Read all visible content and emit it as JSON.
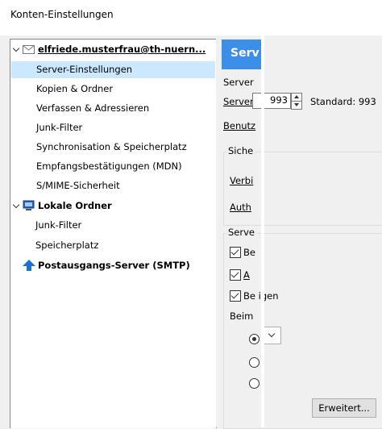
{
  "window": {
    "title": "Konten-Einstellungen"
  },
  "sidebar": {
    "account_email": "elfriede.musterfrau@th-nuern...",
    "account_items": [
      "Server-Einstellungen",
      "Kopien & Ordner",
      "Verfassen & Adressieren",
      "Junk-Filter",
      "Synchronisation & Speicherplatz",
      "Empfangsbestätigungen (MDN)",
      "S/MIME-Sicherheit"
    ],
    "local_folders": "Lokale Ordner",
    "local_items": [
      "Junk-Filter",
      "Speicherplatz"
    ],
    "smtp": "Postausgangs-Server (SMTP)"
  },
  "panel": {
    "header": "Serv",
    "server_label": "Server",
    "port_label": "Server",
    "port_value": "993",
    "standard_label": "Standard:  993",
    "benutzer_label": "Benutz",
    "security_group": "Siche",
    "verbindung_label": "Verbi",
    "auth_label": "Auth",
    "server_settings_group": "Serve",
    "cb1_label": "Be",
    "cb2_label": "A",
    "cb3_label": "Be   igen",
    "beim_label": "Beim",
    "advanced_button": "Erweitert..."
  },
  "colors": {
    "header_blue": "#3d8ee8",
    "selection": "#cce8ff"
  }
}
